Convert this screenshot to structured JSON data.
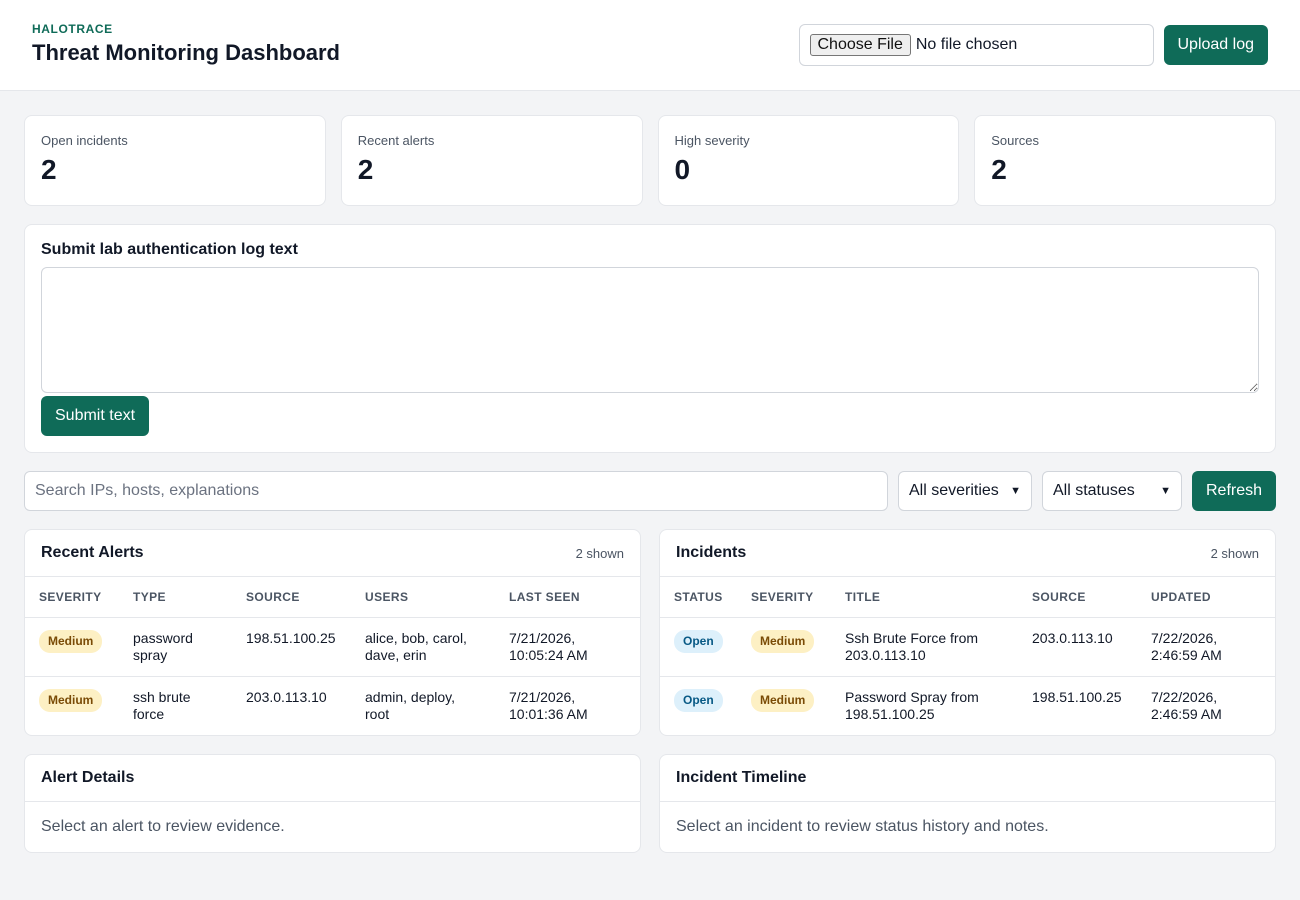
{
  "header": {
    "kicker": "HALOTRACE",
    "title": "Threat Monitoring Dashboard",
    "choose_file_label": "Choose File",
    "file_status": "No file chosen",
    "upload_label": "Upload log"
  },
  "stats": [
    {
      "label": "Open incidents",
      "value": "2"
    },
    {
      "label": "Recent alerts",
      "value": "2"
    },
    {
      "label": "High severity",
      "value": "0"
    },
    {
      "label": "Sources",
      "value": "2"
    }
  ],
  "submit": {
    "title": "Submit lab authentication log text",
    "textarea_value": "",
    "button_label": "Submit text"
  },
  "filters": {
    "search_placeholder": "Search IPs, hosts, explanations",
    "severity_selected": "All severities",
    "status_selected": "All statuses",
    "refresh_label": "Refresh"
  },
  "alerts": {
    "title": "Recent Alerts",
    "count": "2 shown",
    "columns": [
      "SEVERITY",
      "TYPE",
      "SOURCE",
      "USERS",
      "LAST SEEN"
    ],
    "rows": [
      {
        "severity": "Medium",
        "type": "password spray",
        "source": "198.51.100.25",
        "users": "alice, bob, carol, dave, erin",
        "last_seen": "7/21/2026, 10:05:24 AM"
      },
      {
        "severity": "Medium",
        "type": "ssh brute force",
        "source": "203.0.113.10",
        "users": "admin, deploy, root",
        "last_seen": "7/21/2026, 10:01:36 AM"
      }
    ]
  },
  "incidents": {
    "title": "Incidents",
    "count": "2 shown",
    "columns": [
      "STATUS",
      "SEVERITY",
      "TITLE",
      "SOURCE",
      "UPDATED"
    ],
    "rows": [
      {
        "status": "Open",
        "severity": "Medium",
        "title": "Ssh Brute Force from 203.0.113.10",
        "source": "203.0.113.10",
        "updated": "7/22/2026, 2:46:59 AM"
      },
      {
        "status": "Open",
        "severity": "Medium",
        "title": "Password Spray from 198.51.100.25",
        "source": "198.51.100.25",
        "updated": "7/22/2026, 2:46:59 AM"
      }
    ]
  },
  "alert_details": {
    "title": "Alert Details",
    "empty_text": "Select an alert to review evidence."
  },
  "incident_timeline": {
    "title": "Incident Timeline",
    "empty_text": "Select an incident to review status history and notes."
  },
  "colors": {
    "accent": "#0f6b58",
    "background": "#f3f4f6",
    "badge_medium_bg": "#fdf0c4",
    "badge_medium_text": "#7a4b06",
    "badge_open_bg": "#ddf0fb",
    "badge_open_text": "#075985"
  },
  "icons": {
    "select_arrow": "chevron-down-icon"
  }
}
